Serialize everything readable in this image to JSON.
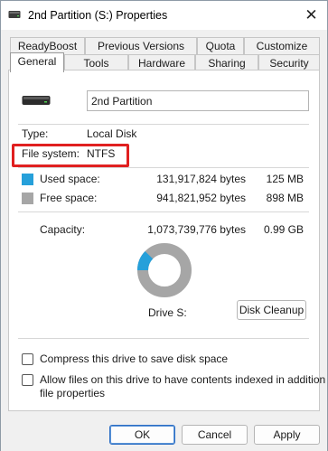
{
  "window": {
    "title": "2nd Partition (S:) Properties",
    "close_glyph": "✕"
  },
  "tabs": {
    "row1": [
      "ReadyBoost",
      "Previous Versions",
      "Quota",
      "Customize"
    ],
    "row2": [
      "General",
      "Tools",
      "Hardware",
      "Sharing",
      "Security"
    ],
    "active": "General"
  },
  "general": {
    "drive_name": "2nd Partition",
    "type_label": "Type:",
    "type_value": "Local Disk",
    "fs_label": "File system:",
    "fs_value": "NTFS",
    "used": {
      "label": "Used space:",
      "bytes": "131,917,824 bytes",
      "size": "125 MB",
      "color": "#26a0da"
    },
    "free": {
      "label": "Free space:",
      "bytes": "941,821,952 bytes",
      "size": "898 MB",
      "color": "#a6a6a6"
    },
    "capacity": {
      "label": "Capacity:",
      "bytes": "1,073,739,776 bytes",
      "size": "0.99 GB"
    },
    "used_fraction": 0.123,
    "drive_label": "Drive S:",
    "disk_cleanup": "Disk Cleanup",
    "compress_label": "Compress this drive to save disk space",
    "index_label_line1": "Allow files on this drive to have contents indexed in addition to",
    "index_label_line2": "file properties",
    "highlight_color": "#e02020"
  },
  "buttons": {
    "ok": "OK",
    "cancel": "Cancel",
    "apply": "Apply"
  },
  "icons": {
    "title": "drive-icon",
    "drive": "hard-drive-icon"
  }
}
